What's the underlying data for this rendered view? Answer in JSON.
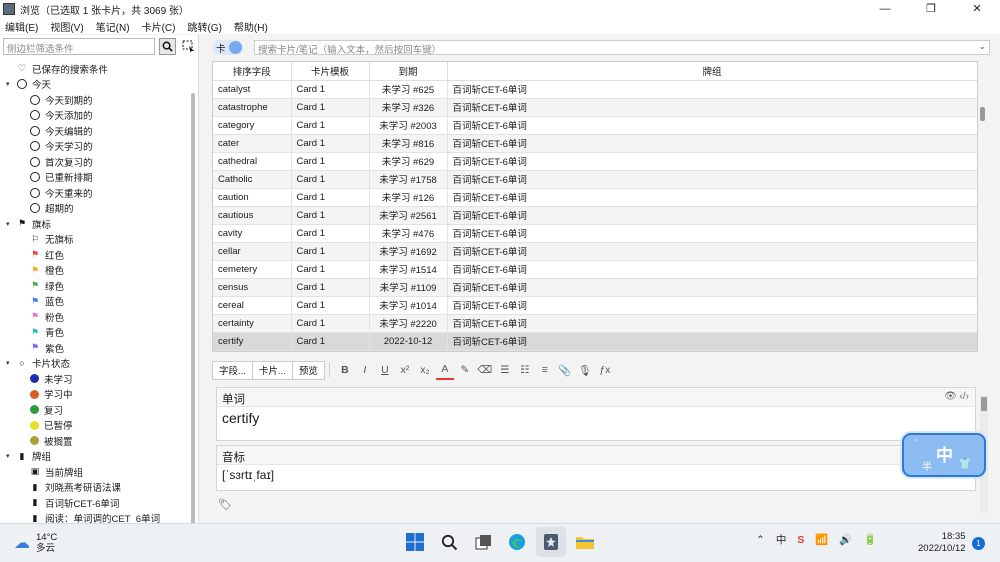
{
  "window": {
    "title": "浏览（已选取 1 张卡片，共 3069 张）",
    "minimize": "—",
    "maximize": "❐",
    "close": "✕"
  },
  "menu": [
    "编辑(E)",
    "视图(V)",
    "笔记(N)",
    "卡片(C)",
    "跳转(G)",
    "帮助(H)"
  ],
  "sidebar": {
    "filter_placeholder": "侧边栏筛选条件",
    "items": [
      {
        "level": 0,
        "icon": "heart-icon",
        "label": "已保存的搜索条件",
        "arrow": ""
      },
      {
        "level": 0,
        "icon": "clock-icon",
        "label": "今天",
        "arrow": "▾"
      },
      {
        "level": 1,
        "icon": "clock-icon",
        "label": "今天到期的"
      },
      {
        "level": 1,
        "icon": "clock-icon",
        "label": "今天添加的"
      },
      {
        "level": 1,
        "icon": "clock-icon",
        "label": "今天编辑的"
      },
      {
        "level": 1,
        "icon": "clock-icon",
        "label": "今天学习的"
      },
      {
        "level": 1,
        "icon": "clock-icon",
        "label": "首次复习的"
      },
      {
        "level": 1,
        "icon": "clock-icon",
        "label": "已重新排期"
      },
      {
        "level": 1,
        "icon": "clock-icon",
        "label": "今天重来的"
      },
      {
        "level": 1,
        "icon": "clock-icon",
        "label": "超期的"
      },
      {
        "level": 0,
        "icon": "flag-icon",
        "label": "旗标",
        "arrow": "▾"
      },
      {
        "level": 1,
        "icon": "no-flag-icon",
        "label": "无旗标"
      },
      {
        "level": 1,
        "icon": "flag-icon",
        "label": "红色",
        "color": "#e64545"
      },
      {
        "level": 1,
        "icon": "flag-icon",
        "label": "橙色",
        "color": "#f5a623"
      },
      {
        "level": 1,
        "icon": "flag-icon",
        "label": "绿色",
        "color": "#4caf50"
      },
      {
        "level": 1,
        "icon": "flag-icon",
        "label": "蓝色",
        "color": "#3b82f6"
      },
      {
        "level": 1,
        "icon": "flag-icon",
        "label": "粉色",
        "color": "#f06fc8"
      },
      {
        "level": 1,
        "icon": "flag-icon",
        "label": "青色",
        "color": "#22c1b5"
      },
      {
        "level": 1,
        "icon": "flag-icon",
        "label": "紫色",
        "color": "#8b5cf6"
      },
      {
        "level": 0,
        "icon": "circle-icon",
        "label": "卡片状态",
        "arrow": "▾"
      },
      {
        "level": 1,
        "icon": "dot-icon",
        "label": "未学习",
        "color": "#1e2fa8"
      },
      {
        "level": 1,
        "icon": "dot-icon",
        "label": "学习中",
        "color": "#d4602a"
      },
      {
        "level": 1,
        "icon": "dot-icon",
        "label": "复习",
        "color": "#2a9d3a"
      },
      {
        "level": 1,
        "icon": "dot-icon",
        "label": "已暂停",
        "color": "#e8e028"
      },
      {
        "level": 1,
        "icon": "dot-icon",
        "label": "被搁置",
        "color": "#a8a23a"
      },
      {
        "level": 0,
        "icon": "deck-icon",
        "label": "牌组",
        "arrow": "▾"
      },
      {
        "level": 1,
        "icon": "current-deck-icon",
        "label": "当前牌组"
      },
      {
        "level": 1,
        "icon": "deck-icon",
        "label": "刘晓燕考研语法课"
      },
      {
        "level": 1,
        "icon": "deck-icon",
        "label": "百词斩CET-6单词"
      },
      {
        "level": 1,
        "icon": "deck-icon",
        "label": "阅读：单词调的CET_6单词"
      }
    ]
  },
  "search": {
    "toggle_label": "卡",
    "placeholder": "搜索卡片/笔记（输入文本，然后按回车键）"
  },
  "table": {
    "headers": [
      "排序字段",
      "卡片模板",
      "到期",
      "牌组"
    ],
    "rows": [
      [
        "catalyst",
        "Card 1",
        "未学习 #625",
        "百词斩CET-6单词"
      ],
      [
        "catastrophe",
        "Card 1",
        "未学习 #326",
        "百词斩CET-6单词"
      ],
      [
        "category",
        "Card 1",
        "未学习 #2003",
        "百词斩CET-6单词"
      ],
      [
        "cater",
        "Card 1",
        "未学习 #816",
        "百词斩CET-6单词"
      ],
      [
        "cathedral",
        "Card 1",
        "未学习 #629",
        "百词斩CET-6单词"
      ],
      [
        "Catholic",
        "Card 1",
        "未学习 #1758",
        "百词斩CET-6单词"
      ],
      [
        "caution",
        "Card 1",
        "未学习 #126",
        "百词斩CET-6单词"
      ],
      [
        "cautious",
        "Card 1",
        "未学习 #2561",
        "百词斩CET-6单词"
      ],
      [
        "cavity",
        "Card 1",
        "未学习 #476",
        "百词斩CET-6单词"
      ],
      [
        "cellar",
        "Card 1",
        "未学习 #1692",
        "百词斩CET-6单词"
      ],
      [
        "cemetery",
        "Card 1",
        "未学习 #1514",
        "百词斩CET-6单词"
      ],
      [
        "census",
        "Card 1",
        "未学习 #1109",
        "百词斩CET-6单词"
      ],
      [
        "cereal",
        "Card 1",
        "未学习 #1014",
        "百词斩CET-6单词"
      ],
      [
        "certainty",
        "Card 1",
        "未学习 #2220",
        "百词斩CET-6单词"
      ],
      [
        "certify",
        "Card 1",
        "2022-10-12",
        "百词斩CET-6单词"
      ]
    ],
    "selected_index": 14
  },
  "editor": {
    "fields_btn": "字段...",
    "cards_btn": "卡片...",
    "preview_btn": "预览",
    "tools": [
      "B",
      "I",
      "U",
      "x²",
      "x₂",
      "A",
      "✎",
      "⌫",
      "☰",
      "☷",
      "≡",
      "📎",
      "🎙",
      "ƒx"
    ],
    "fields": [
      {
        "name": "单词",
        "value": "certify"
      },
      {
        "name": "音标",
        "value": "[ˈsɜrtɪˌfaɪ]"
      }
    ]
  },
  "ime": {
    "main": "中",
    "half": "半",
    "deg": "°"
  },
  "taskbar": {
    "temp": "14°C",
    "weather": "多云",
    "tray_ime": "中",
    "time": "18:35",
    "date": "2022/10/12",
    "notifications": "1"
  }
}
